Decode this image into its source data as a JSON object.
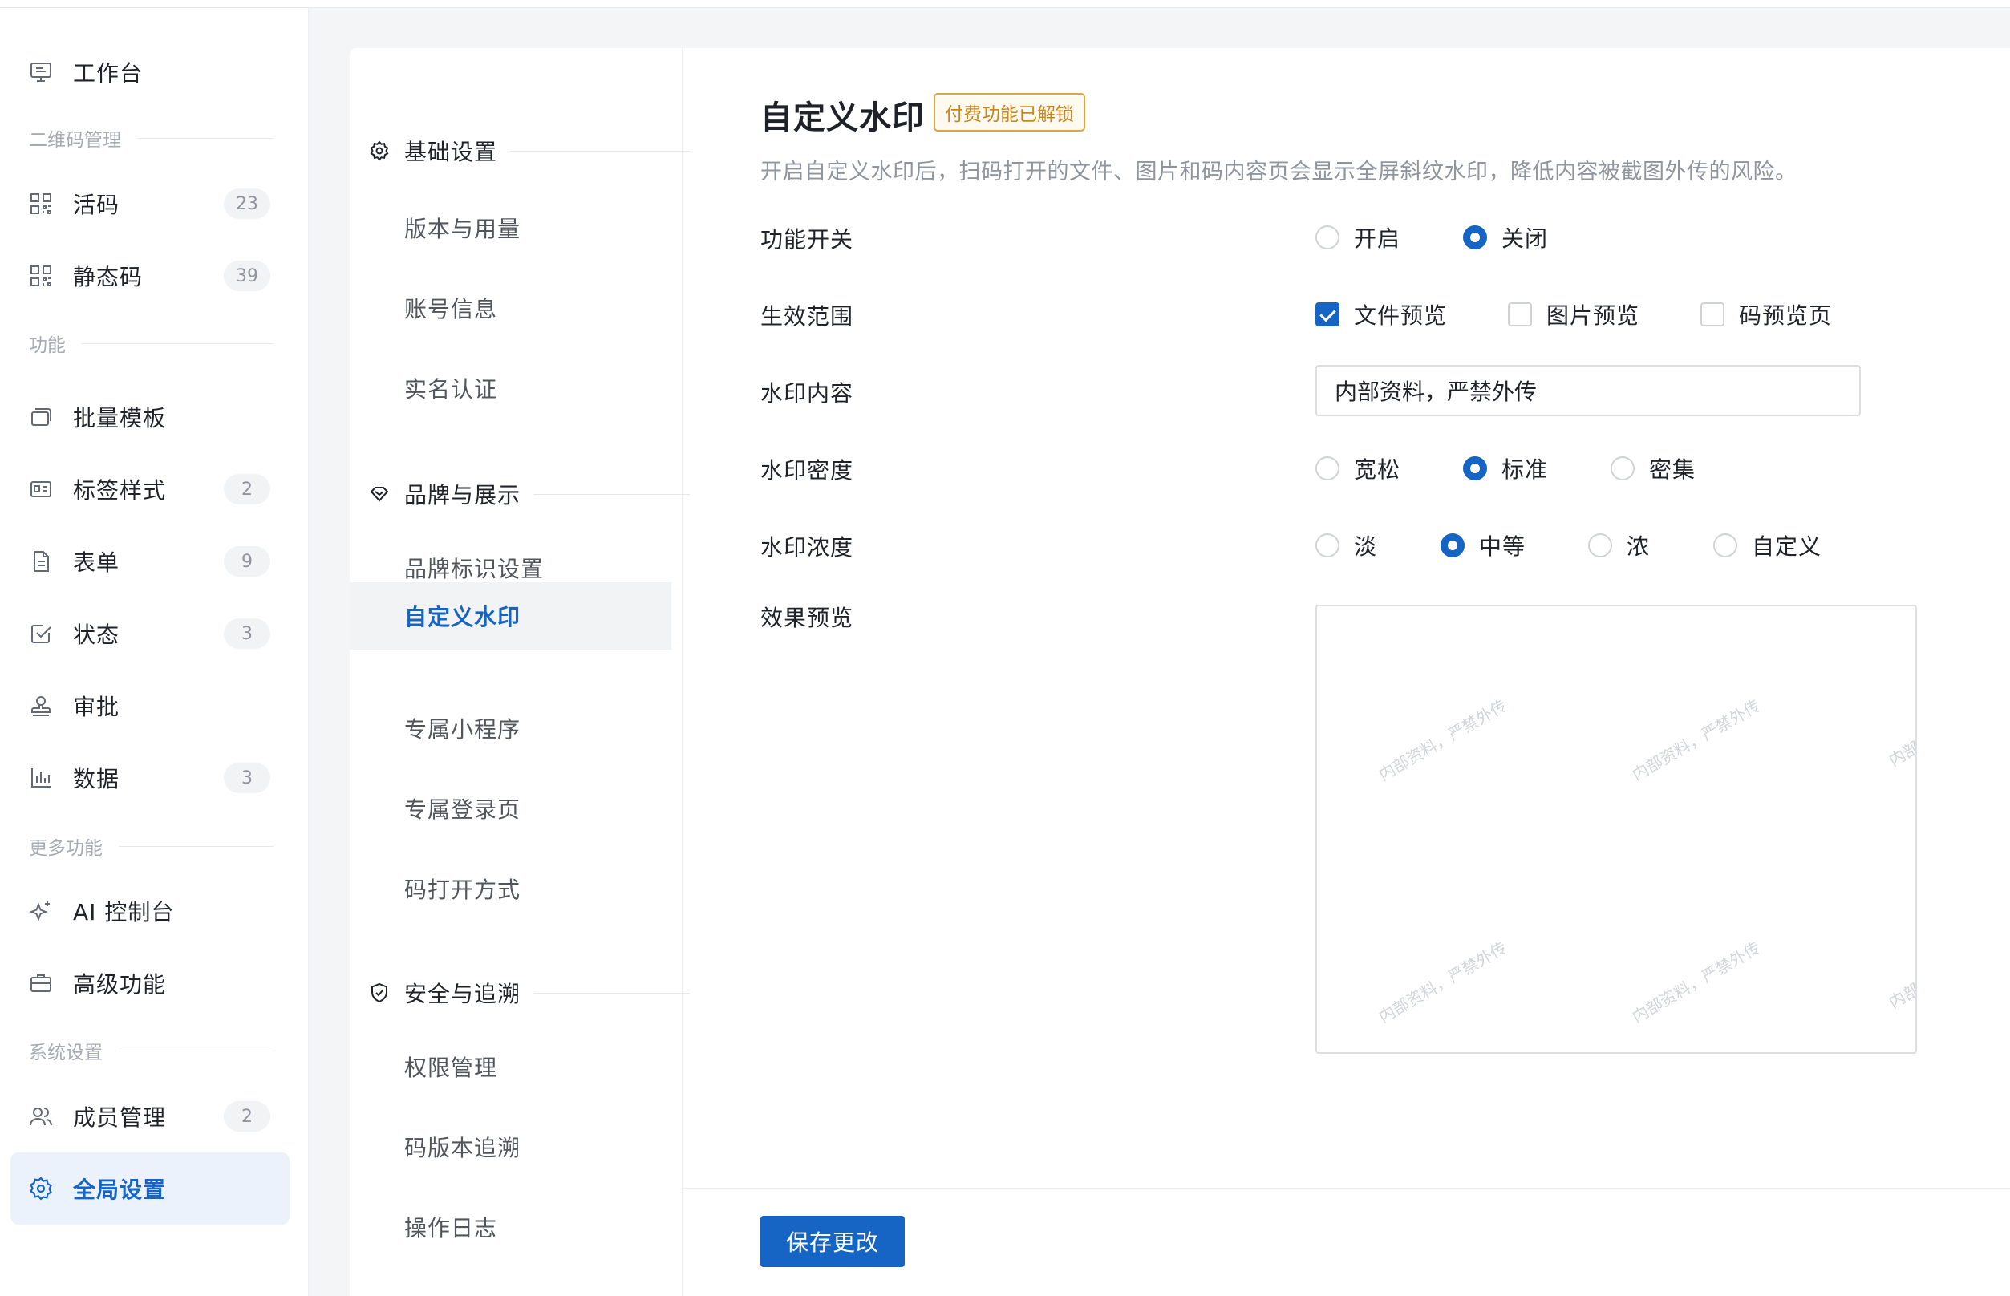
{
  "sidebar": {
    "workbench": "工作台",
    "sections": {
      "qrcode": "二维码管理",
      "features": "功能",
      "more": "更多功能",
      "system": "系统设置"
    },
    "items": {
      "live_code": {
        "label": "活码",
        "badge": "23"
      },
      "static_code": {
        "label": "静态码",
        "badge": "39"
      },
      "batch_template": {
        "label": "批量模板"
      },
      "label_style": {
        "label": "标签样式",
        "badge": "2"
      },
      "form": {
        "label": "表单",
        "badge": "9"
      },
      "status": {
        "label": "状态",
        "badge": "3"
      },
      "approval": {
        "label": "审批"
      },
      "data": {
        "label": "数据",
        "badge": "3"
      },
      "ai_console": {
        "label": "AI 控制台"
      },
      "advanced": {
        "label": "高级功能"
      },
      "members": {
        "label": "成员管理",
        "badge": "2"
      },
      "global_settings": {
        "label": "全局设置"
      }
    }
  },
  "subnav": {
    "groups": {
      "basic": "基础设置",
      "brand": "品牌与展示",
      "security": "安全与追溯"
    },
    "items": {
      "version": "版本与用量",
      "account": "账号信息",
      "realname": "实名认证",
      "brand_logo": "品牌标识设置",
      "watermark": "自定义水印",
      "miniprogram": "专属小程序",
      "login_page": "专属登录页",
      "open_method": "码打开方式",
      "permission": "权限管理",
      "version_trace": "码版本追溯",
      "oplog": "操作日志"
    }
  },
  "content": {
    "title": "自定义水印",
    "badge": "付费功能已解锁",
    "description": "开启自定义水印后，扫码打开的文件、图片和码内容页会显示全屏斜纹水印，降低内容被截图外传的风险。",
    "labels": {
      "switch": "功能开关",
      "scope": "生效范围",
      "content": "水印内容",
      "density": "水印密度",
      "opacity": "水印浓度",
      "preview": "效果预览"
    },
    "switch_options": {
      "on": "开启",
      "off": "关闭",
      "selected": "关闭"
    },
    "scope_options": {
      "file": "文件预览",
      "image": "图片预览",
      "code": "码预览页",
      "checked": [
        "文件预览"
      ]
    },
    "watermark_text": "内部资料，严禁外传",
    "density_options": {
      "loose": "宽松",
      "standard": "标准",
      "dense": "密集",
      "selected": "标准"
    },
    "opacity_options": {
      "light": "淡",
      "medium": "中等",
      "strong": "浓",
      "custom": "自定义",
      "selected": "中等"
    },
    "preview_watermarks": [
      "内部资料，严禁外传",
      "内部资料，严禁外传",
      "内部",
      "内部资料，严禁外传",
      "内部资料，严禁外传",
      "内部"
    ],
    "save_label": "保存更改"
  },
  "colors": {
    "accent": "#1664c4",
    "badge_border": "#d9a44a",
    "badge_text": "#c7871e"
  }
}
